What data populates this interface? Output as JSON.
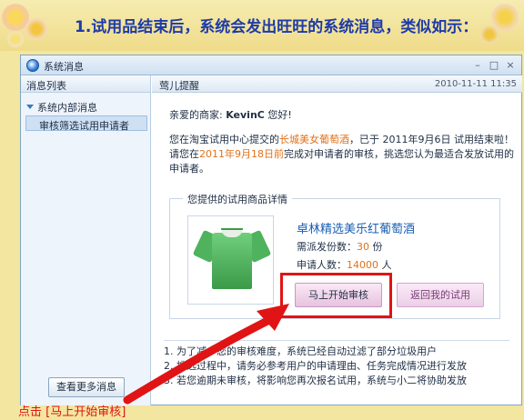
{
  "banner": {
    "title": "1.试用品结束后，系统会发出旺旺的系统消息，类似如示："
  },
  "window": {
    "title": "系统消息",
    "controls": {
      "minimize": "–",
      "maximize": "□",
      "close": "×"
    }
  },
  "sidebar": {
    "header": "消息列表",
    "root_label": "系统内部消息",
    "selected_item": "审核筛选试用申请者",
    "more_button": "查看更多消息"
  },
  "message": {
    "sender": "莺儿提醒",
    "time": "2010-11-11  11:35",
    "greeting_prefix": "亲爱的商家:",
    "greeting_name": "KevinC",
    "greeting_suffix": "您好!",
    "body_1": "您在淘宝试用中心提交的",
    "product_link": "长城美女葡萄酒",
    "body_2": "，已于 2011年9月6日 试用结束啦！请您在",
    "deadline": "2011年9月18日前",
    "body_3": "完成对申请者的审核，挑选您认为最适合发放试用的申请者。"
  },
  "details": {
    "legend": "您提供的试用商品详情",
    "product_name": "卓林精选美乐红葡萄酒",
    "quota_label": "需派发份数：",
    "quota_value": "30",
    "quota_unit": "份",
    "applicants_label": "申请人数：",
    "applicants_value": "14000",
    "applicants_unit": "人",
    "start_button": "马上开始审核",
    "back_button": "返回我的试用"
  },
  "notes": [
    "1. 为了减少您的审核难度，系统已经自动过滤了部分垃圾用户",
    "2. 挑选过程中，请务必参考用户的申请理由、任务完成情况进行发放",
    "3. 若您逾期未审核，将影响您再次报名试用，系统与小二将协助发放"
  ],
  "caption": "点击 [马上开始审核]",
  "colors": {
    "accent_orange": "#e0721c",
    "annotation_red": "#e01414",
    "title_blue": "#1d3aa8"
  }
}
